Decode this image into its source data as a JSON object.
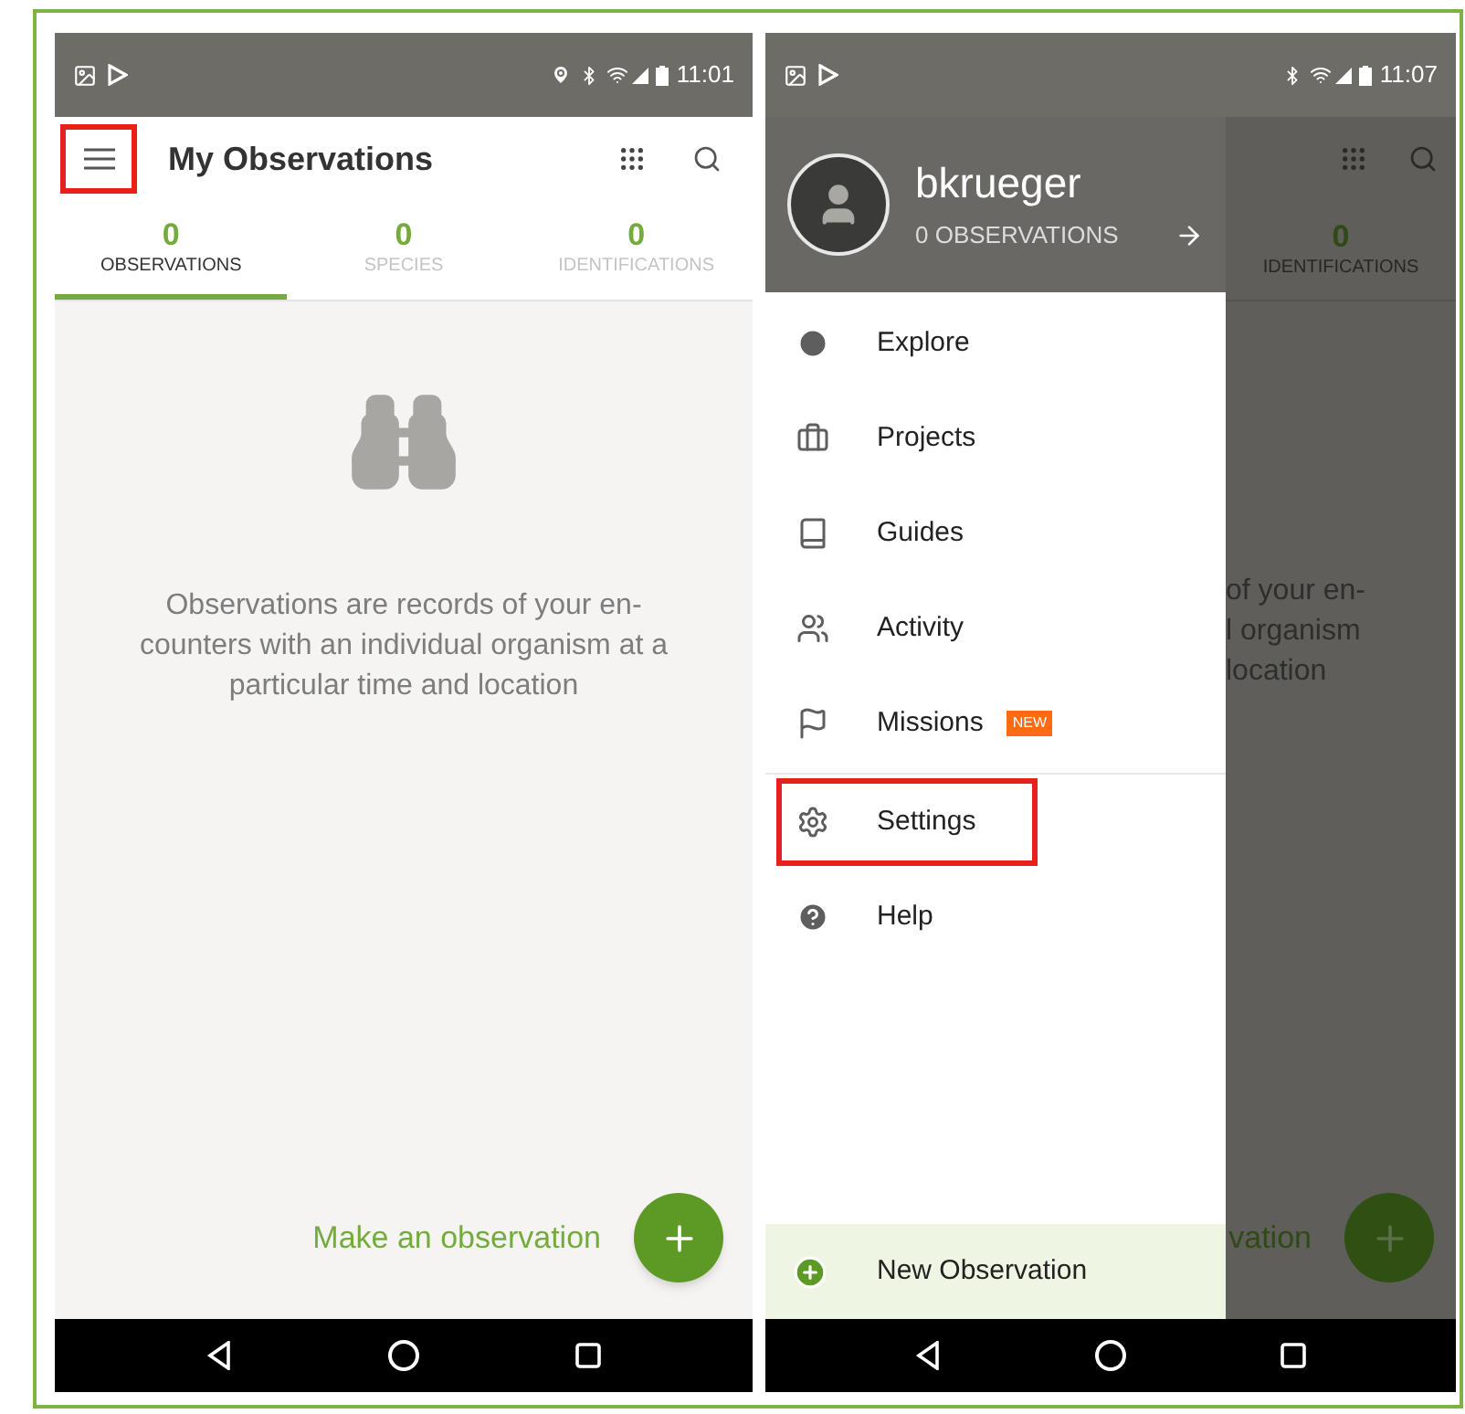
{
  "left_screen": {
    "status_bar": {
      "time": "11:01",
      "location": true
    },
    "app_bar": {
      "title": "My Observations",
      "menu_highlighted": true
    },
    "tabs": [
      {
        "count": "0",
        "label": "OBSERVATIONS",
        "selected": true
      },
      {
        "count": "0",
        "label": "SPECIES",
        "selected": false
      },
      {
        "count": "0",
        "label": "IDENTIFICATIONS",
        "selected": false
      }
    ],
    "empty_message": "Observations are records of your en- counters with an individual organism at a particular time and location",
    "action_label": "Make an observation"
  },
  "right_screen": {
    "status_bar": {
      "time": "11:07",
      "location": false
    },
    "drawer": {
      "username": "bkrueger",
      "subtitle": "0 OBSERVATIONS",
      "items": [
        {
          "kind": "explore",
          "label": "Explore",
          "highlighted": false
        },
        {
          "kind": "projects",
          "label": "Projects",
          "highlighted": false
        },
        {
          "kind": "guides",
          "label": "Guides",
          "highlighted": false
        },
        {
          "kind": "activity",
          "label": "Activity",
          "highlighted": false
        },
        {
          "kind": "missions",
          "label": "Missions",
          "badge": "NEW",
          "highlighted": false
        },
        {
          "kind": "settings",
          "label": "Settings",
          "highlighted": true
        },
        {
          "kind": "help",
          "label": "Help",
          "highlighted": false
        }
      ],
      "footer": "New Observation"
    },
    "background": {
      "tab_count": "0",
      "tab_label": "IDENTIFICATIONS",
      "message_lines": [
        "of your en-",
        "l organism",
        "location"
      ],
      "action_label": "vation"
    }
  }
}
